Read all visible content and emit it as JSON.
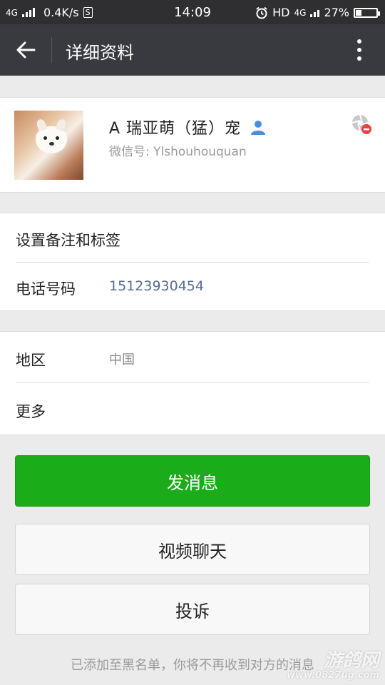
{
  "status_bar": {
    "network": "4G",
    "speed": "0.4K/s",
    "speed_icon": "s-icon",
    "time": "14:09",
    "hd": "HD",
    "network_right": "4G",
    "battery_pct": "27%",
    "battery_level": 0.27
  },
  "title_bar": {
    "title": "详细资料"
  },
  "profile": {
    "name": "A 瑞亚萌（猛）宠",
    "wechat_id": "微信号: Ylshouhouquan"
  },
  "info_rows": {
    "remark_label": "设置备注和标签",
    "phone_label": "电话号码",
    "phone_value": "15123930454",
    "region_label": "地区",
    "region_value": "中国",
    "more_label": "更多"
  },
  "buttons": {
    "send_message": "发消息",
    "video_chat": "视频聊天",
    "report": "投诉"
  },
  "notice": "已添加至黑名单，你将不再收到对方的消息",
  "watermark": {
    "line1": "游鸽网",
    "line2": "www.0827ug.com"
  },
  "colors": {
    "title_bar": "#393a3f",
    "status_bar": "#2f2f31",
    "primary_green": "#1aad19",
    "phone_blue": "#576b95",
    "background": "#ebebeb"
  }
}
